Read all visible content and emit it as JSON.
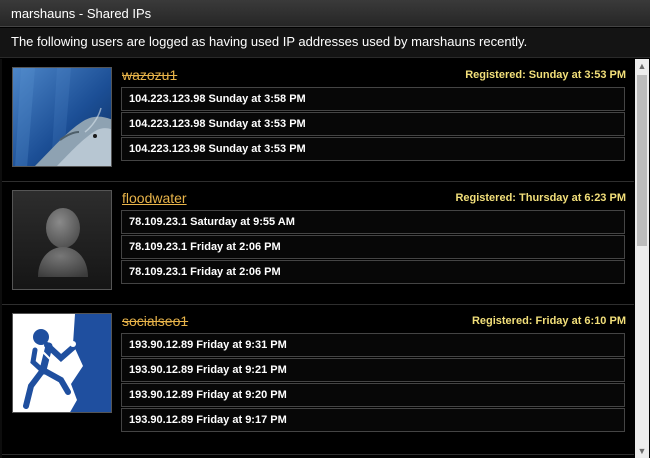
{
  "window": {
    "title": "marshauns - Shared IPs"
  },
  "header": {
    "description": "The following users are logged as having used IP addresses used by marshauns recently."
  },
  "users": [
    {
      "username": "wazozu1",
      "registered": "Registered: Sunday at 3:53 PM",
      "ips": [
        "104.223.123.98 Sunday at 3:58 PM",
        "104.223.123.98 Sunday at 3:53 PM",
        "104.223.123.98 Sunday at 3:53 PM"
      ]
    },
    {
      "username": "floodwater",
      "registered": "Registered: Thursday at 6:23 PM",
      "ips": [
        "78.109.23.1 Saturday at 9:55 AM",
        "78.109.23.1 Friday at 2:06 PM",
        "78.109.23.1 Friday at 2:06 PM"
      ]
    },
    {
      "username": "socialseo1",
      "registered": "Registered: Friday at 6:10 PM",
      "ips": [
        "193.90.12.89 Friday at 9:31 PM",
        "193.90.12.89 Friday at 9:21 PM",
        "193.90.12.89 Friday at 9:20 PM",
        "193.90.12.89 Friday at 9:17 PM"
      ]
    }
  ],
  "icons": {
    "scroll_up": "▲",
    "scroll_down": "▼"
  }
}
